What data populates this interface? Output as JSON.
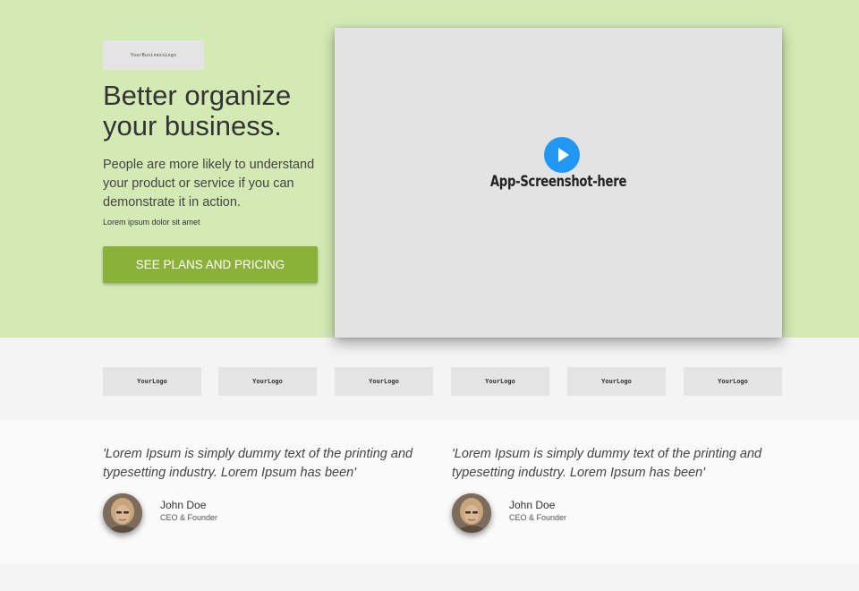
{
  "hero": {
    "business_logo": "YourBusinessLogo",
    "title": "Better organize your business.",
    "description": "People are more likely to understand your product or service if you can demonstrate it in action.",
    "small_text": "Lorem ipsum dolor sit amet",
    "cta_label": "SEE PLANS AND PRICING",
    "background_color": "#d3eab5",
    "cta_color": "#8bb13a"
  },
  "screenshot": {
    "label": "App-Screenshot-here",
    "play_icon": "play-icon",
    "play_color": "#2196f3"
  },
  "partner_logos": [
    "YourLogo",
    "YourLogo",
    "YourLogo",
    "YourLogo",
    "YourLogo",
    "YourLogo"
  ],
  "testimonials": [
    {
      "quote": "'Lorem Ipsum is simply dummy text of the printing and typesetting industry. Lorem Ipsum has been'",
      "name": "John Doe",
      "role": "CEO & Founder"
    },
    {
      "quote": "'Lorem Ipsum is simply dummy text of the printing and typesetting industry. Lorem Ipsum has been'",
      "name": "John Doe",
      "role": "CEO & Founder"
    }
  ]
}
